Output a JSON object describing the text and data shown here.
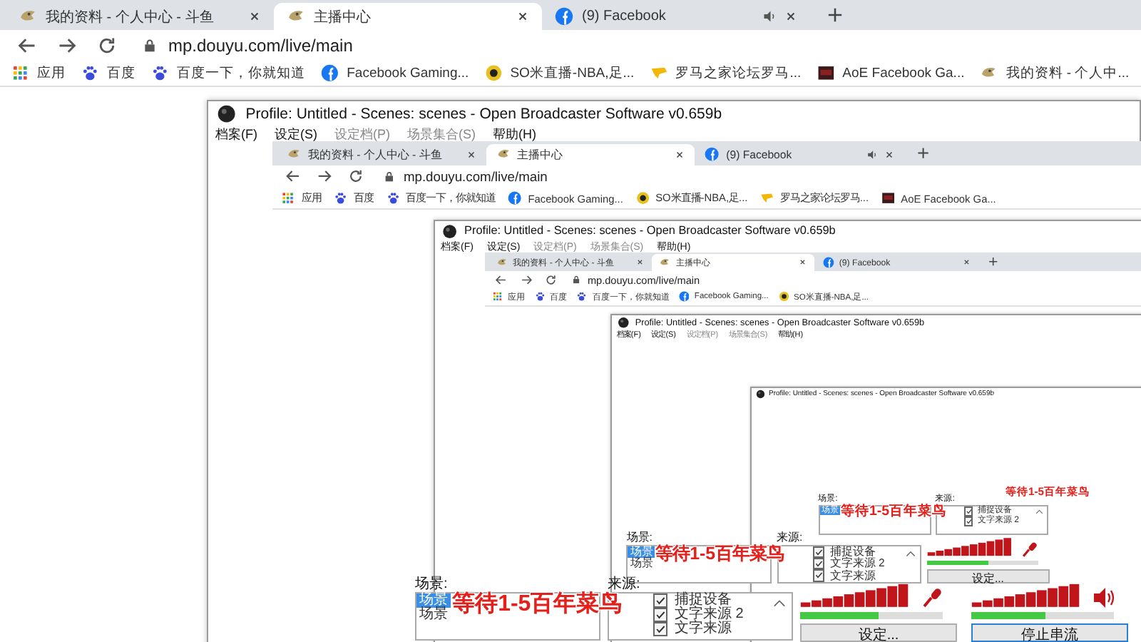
{
  "screens": [
    {
      "browser": {
        "tabs": [
          {
            "title": "我的资料 - 个人中心 - 斗鱼",
            "kind": "site",
            "selected": false,
            "audio": false
          },
          {
            "title": "主播中心",
            "kind": "site",
            "selected": true,
            "audio": false
          },
          {
            "title": "(9) Facebook",
            "kind": "social",
            "selected": false,
            "audio": true
          }
        ],
        "url": "mp.douyu.com/live/main",
        "bookmarks": [
          {
            "label": "应用",
            "kind": "apps"
          },
          {
            "label": "百度",
            "kind": "paw"
          },
          {
            "label": "百度一下，你就知道",
            "kind": "paw"
          },
          {
            "label": "Facebook Gaming...",
            "kind": "social"
          },
          {
            "label": "SO米直播-NBA,足...",
            "kind": "ball"
          },
          {
            "label": "罗马之家论坛罗马...",
            "kind": "flag"
          },
          {
            "label": "AoE Facebook Ga...",
            "kind": "tile"
          },
          {
            "label": "我的资料 - 个人中...",
            "kind": "site"
          }
        ]
      },
      "obs": {
        "title": "Profile: Untitled - Scenes: scenes - Open Broadcaster Software v0.659b",
        "menu": [
          {
            "label": "档案(F)",
            "disabled": false
          },
          {
            "label": "设定(S)",
            "disabled": false
          },
          {
            "label": "设定档(P)",
            "disabled": true
          },
          {
            "label": "场景集合(S)",
            "disabled": true
          },
          {
            "label": "帮助(H)",
            "disabled": false
          }
        ],
        "panel": {
          "scenes_label": "场景:",
          "scenes": [
            {
              "label": "场景",
              "selected": true
            },
            {
              "label": "场景",
              "selected": false
            }
          ],
          "overlay": "等待1-5百年菜鸟",
          "sources_label": "来源:",
          "sources": [
            {
              "label": "捕捉设备",
              "checked": true
            },
            {
              "label": "文字来源 2",
              "checked": true
            },
            {
              "label": "文字来源",
              "checked": true
            }
          ],
          "meters": [
            {
              "kind": "mic",
              "level": 0.55
            },
            {
              "kind": "speaker",
              "level": 0.52
            }
          ],
          "buttons": [
            {
              "label": "设定...",
              "focused": false
            },
            {
              "label": "停止串流",
              "focused": true
            }
          ]
        }
      }
    },
    {
      "browser": {
        "tabs": [
          {
            "title": "我的资料 - 个人中心 - 斗鱼",
            "kind": "site",
            "selected": false,
            "audio": false
          },
          {
            "title": "主播中心",
            "kind": "site",
            "selected": true,
            "audio": false
          },
          {
            "title": "(9) Facebook",
            "kind": "social",
            "selected": false,
            "audio": true
          }
        ],
        "url": "mp.douyu.com/live/main",
        "bookmarks": [
          {
            "label": "应用",
            "kind": "apps"
          },
          {
            "label": "百度",
            "kind": "paw"
          },
          {
            "label": "百度一下，你就知道",
            "kind": "paw"
          },
          {
            "label": "Facebook Gaming...",
            "kind": "social"
          },
          {
            "label": "SO米直播-NBA,足...",
            "kind": "ball"
          },
          {
            "label": "罗马之家论坛罗马...",
            "kind": "flag"
          },
          {
            "label": "AoE Facebook Ga...",
            "kind": "tile"
          }
        ]
      },
      "obs": {
        "title": "Profile: Untitled - Scenes: scenes - Open Broadcaster Software v0.659b",
        "menu": [
          {
            "label": "档案(F)",
            "disabled": false
          },
          {
            "label": "设定(S)",
            "disabled": false
          },
          {
            "label": "设定档(P)",
            "disabled": true
          },
          {
            "label": "场景集合(S)",
            "disabled": true
          },
          {
            "label": "帮助(H)",
            "disabled": false
          }
        ],
        "panel": {
          "scenes_label": "场景:",
          "scenes": [
            {
              "label": "场景",
              "selected": true
            },
            {
              "label": "场景",
              "selected": false
            }
          ],
          "overlay": "等待1-5百年菜鸟",
          "sources_label": "来源:",
          "sources": [
            {
              "label": "捕捉设备",
              "checked": true
            },
            {
              "label": "文字来源 2",
              "checked": true
            },
            {
              "label": "文字来源",
              "checked": true
            }
          ],
          "meters": [
            {
              "kind": "mic",
              "level": 0.55
            }
          ],
          "buttons": [
            {
              "label": "设定...",
              "focused": false
            }
          ]
        }
      }
    },
    {
      "browser": {
        "tabs": [
          {
            "title": "我的资料 - 个人中心 - 斗鱼",
            "kind": "site",
            "selected": false,
            "audio": false
          },
          {
            "title": "主播中心",
            "kind": "site",
            "selected": true,
            "audio": false
          },
          {
            "title": "(9) Facebook",
            "kind": "social",
            "selected": false,
            "audio": false
          }
        ],
        "url": "mp.douyu.com/live/main",
        "bookmarks": [
          {
            "label": "应用",
            "kind": "apps"
          },
          {
            "label": "百度",
            "kind": "paw"
          },
          {
            "label": "百度一下，你就知道",
            "kind": "paw"
          },
          {
            "label": "Facebook Gaming...",
            "kind": "social"
          },
          {
            "label": "SO米直播-NBA,足...",
            "kind": "ball"
          }
        ]
      },
      "obs": {
        "title": "Profile: Untitled - Scenes: scenes - Open Broadcaster Software v0.659b",
        "menu": [
          {
            "label": "档案(F)",
            "disabled": false
          },
          {
            "label": "设定(S)",
            "disabled": false
          },
          {
            "label": "设定档(P)",
            "disabled": true
          },
          {
            "label": "场景集合(S)",
            "disabled": true
          },
          {
            "label": "帮助(H)",
            "disabled": false
          }
        ],
        "panel": {
          "scenes_label": "场景:",
          "scenes": [
            {
              "label": "场景",
              "selected": true
            }
          ],
          "overlay": "等待1-5百年菜鸟",
          "sources_label": "来源:",
          "sources": [
            {
              "label": "捕捉设备",
              "checked": true
            },
            {
              "label": "文字来源 2",
              "checked": true
            }
          ]
        }
      }
    },
    {
      "obs": {
        "title": "Profile: Untitled - Scenes: scenes - Open Broadcaster Software v0.659b",
        "panel": {
          "overlay": "等待1-5百年菜鸟"
        }
      }
    }
  ]
}
